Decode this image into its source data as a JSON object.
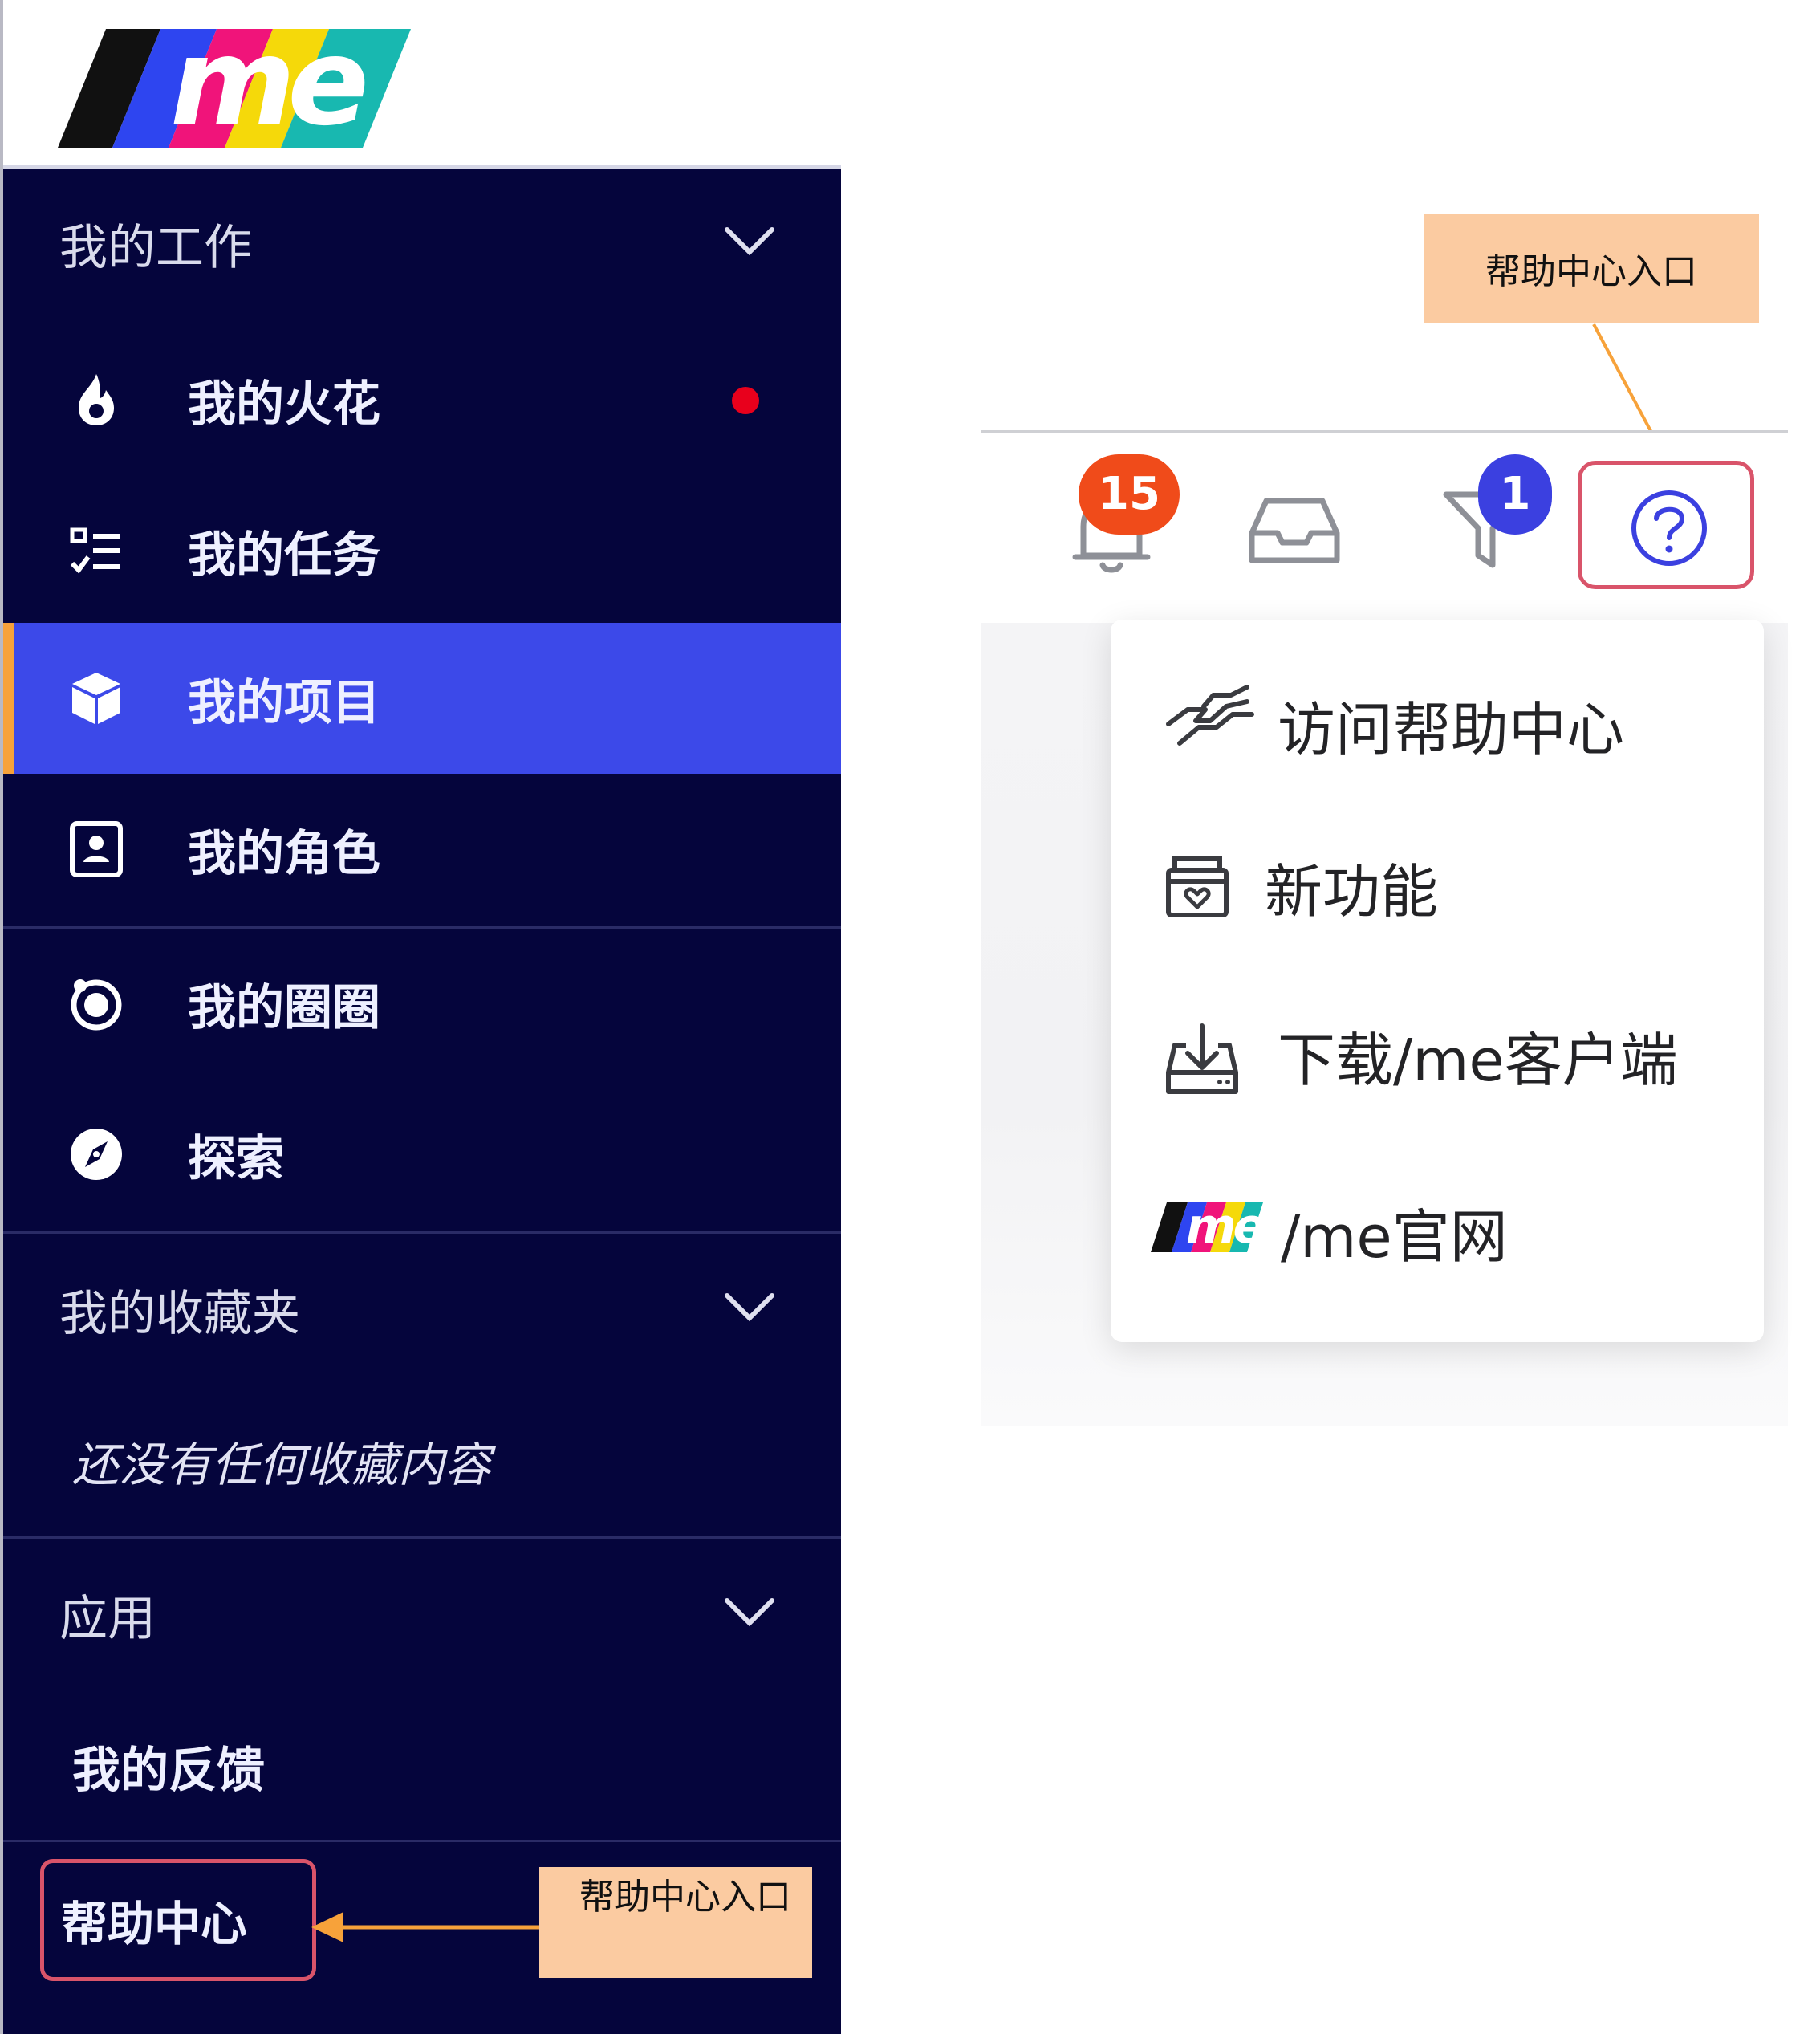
{
  "sidebar": {
    "brand": "/me",
    "sections": [
      {
        "title": "我的工作"
      },
      {
        "title": "我的收藏夹"
      },
      {
        "title": "应用"
      }
    ],
    "items": [
      {
        "label": "我的火花",
        "icon": "flame-icon",
        "has_notification": true
      },
      {
        "label": "我的任务",
        "icon": "task-list-icon"
      },
      {
        "label": "我的项目",
        "icon": "cube-icon",
        "active": true
      },
      {
        "label": "我的角色",
        "icon": "id-card-icon"
      },
      {
        "label": "我的圈圈",
        "icon": "circle-icon"
      },
      {
        "label": "探索",
        "icon": "compass-icon"
      }
    ],
    "favorites_empty": "还没有任何收藏内容",
    "apps_item": "我的反馈",
    "help": "帮助中心"
  },
  "callouts": {
    "top": "帮助中心入口",
    "bottom": "帮助中心入口"
  },
  "toolbar": {
    "notifications_count": "15",
    "filter_count": "1"
  },
  "help_menu": {
    "items": [
      {
        "label": "访问帮助中心",
        "icon": "handshake-icon"
      },
      {
        "label": "新功能",
        "icon": "gift-box-icon"
      },
      {
        "label": "下载/me客户端",
        "icon": "download-icon"
      },
      {
        "label": "/me官网",
        "icon": "me-logo-icon"
      }
    ]
  },
  "colors": {
    "sidebar_bg": "#05053c",
    "active_bg": "#3c49e9",
    "accent_orange": "#f7a23a",
    "badge_red": "#f04b1a",
    "badge_blue": "#3b40e0",
    "highlight_border": "#d9546a",
    "callout_bg": "#fbcba1"
  }
}
